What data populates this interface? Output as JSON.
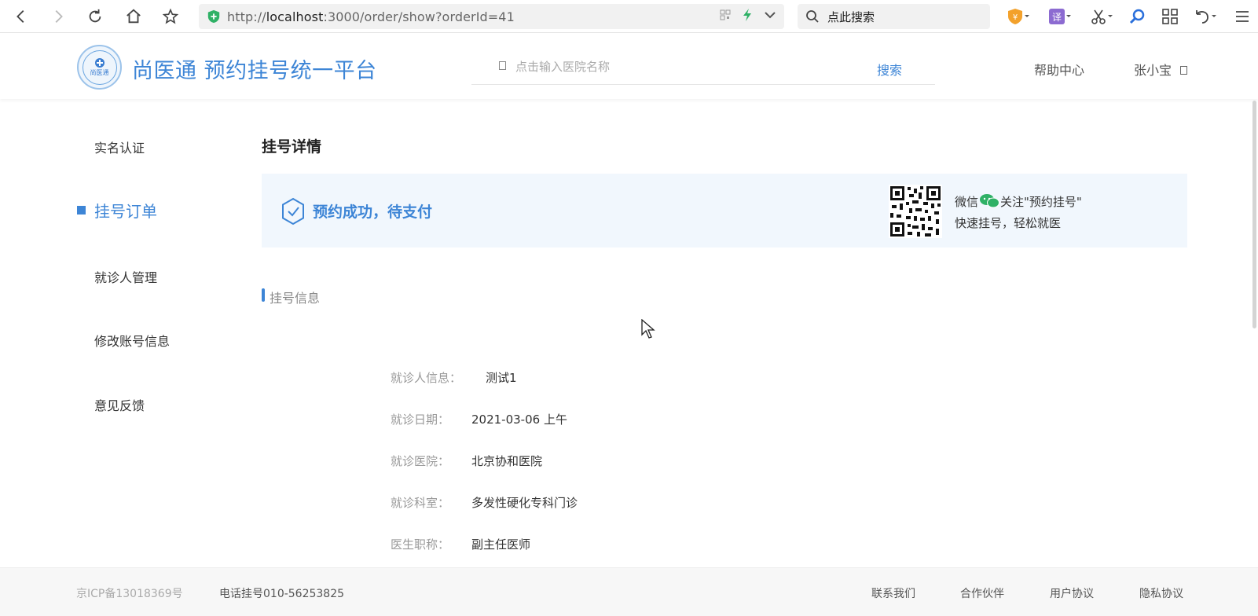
{
  "browser": {
    "url_prefix": "http://",
    "url_host": "localhost",
    "url_rest": ":3000/order/show?orderId=41",
    "search_text": "点此搜索"
  },
  "header": {
    "logo_text": "尚医通",
    "brand": "尚医通 预约挂号统一平台",
    "search_placeholder": "点击输入医院名称",
    "search_button": "搜索",
    "help": "帮助中心",
    "user": "张小宝"
  },
  "sidebar": {
    "items": [
      {
        "label": "实名认证"
      },
      {
        "label": "挂号订单"
      },
      {
        "label": "就诊人管理"
      },
      {
        "label": "修改账号信息"
      },
      {
        "label": "意见反馈"
      }
    ]
  },
  "main": {
    "title": "挂号详情",
    "status": "预约成功，待支付",
    "wechat_line1_a": "微信",
    "wechat_line1_b": "关注\"预约挂号\"",
    "wechat_line2": "快速挂号，轻松就医",
    "section_title": "挂号信息",
    "info": [
      {
        "label": "就诊人信息：",
        "value": "测试1"
      },
      {
        "label": "就诊日期：",
        "value": "2021-03-06 上午"
      },
      {
        "label": "就诊医院：",
        "value": "北京协和医院"
      },
      {
        "label": "就诊科室：",
        "value": "多发性硬化专科门诊"
      },
      {
        "label": "医生职称：",
        "value": "副主任医师"
      }
    ]
  },
  "footer": {
    "icp": "京ICP备13018369号",
    "tel": "电话挂号010-56253825",
    "links": [
      {
        "label": "联系我们"
      },
      {
        "label": "合作伙伴"
      },
      {
        "label": "用户协议"
      },
      {
        "label": "隐私协议"
      }
    ]
  },
  "colors": {
    "accent": "#3d85d6",
    "status_bg": "#f1f7fd"
  }
}
